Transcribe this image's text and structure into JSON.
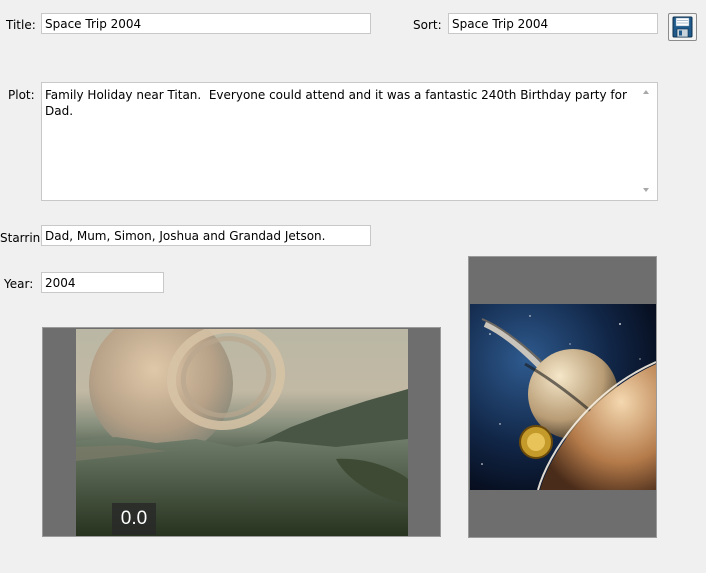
{
  "fields": {
    "title_label": "Title:",
    "title_value": "Space Trip 2004",
    "sort_label": "Sort:",
    "sort_value": "Space Trip 2004",
    "plot_label": "Plot:",
    "plot_value": "Family Holiday near Titan.  Everyone could attend and it was a fantastic 240th Birthday party for Dad.",
    "starring_label": "Starrin",
    "starring_value": "Dad, Mum, Simon, Joshua and Grandad Jetson.",
    "year_label": "Year:",
    "year_value": "2004"
  },
  "toolbar": {
    "save_icon": "floppy-disk-icon"
  },
  "media": {
    "fanart_counter": "0.0"
  }
}
